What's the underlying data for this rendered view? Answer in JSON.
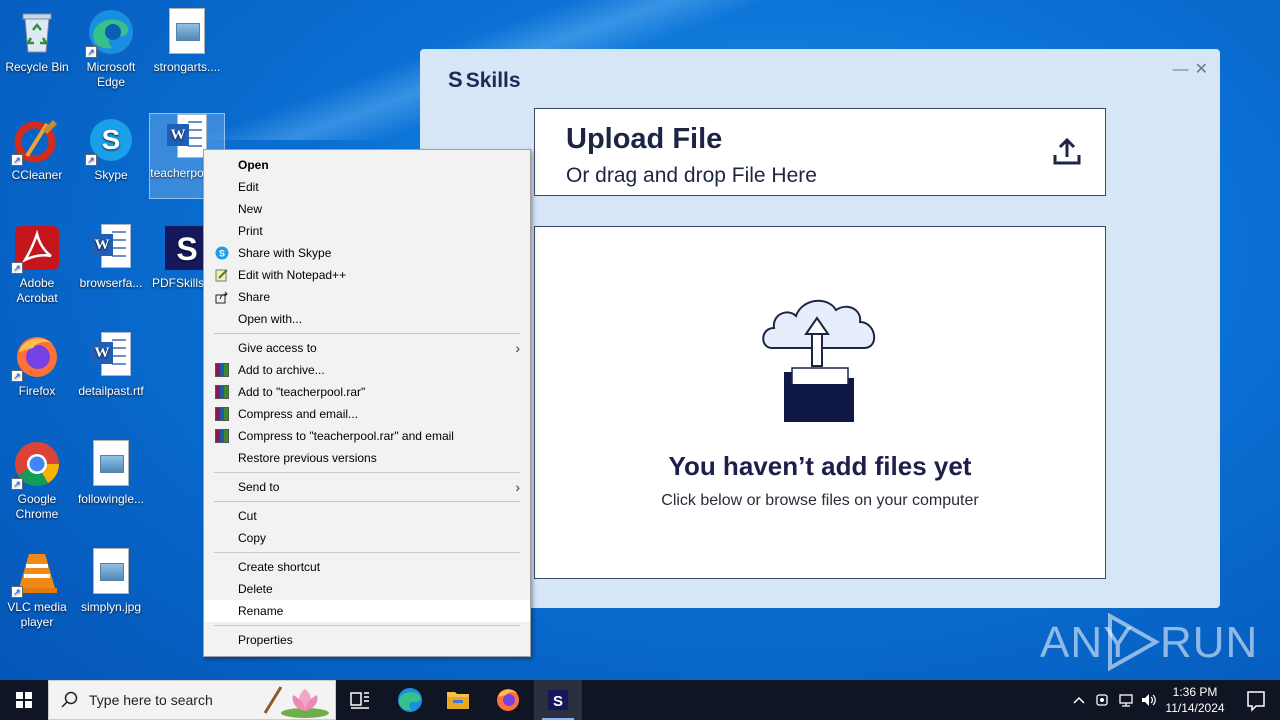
{
  "desktop": {
    "icons": [
      {
        "label": "Recycle Bin"
      },
      {
        "label": "Microsoft Edge"
      },
      {
        "label": "strongarts...."
      },
      {
        "label": "CCleaner"
      },
      {
        "label": "Skype"
      },
      {
        "label": "teacherpo... tf"
      },
      {
        "label": "Adobe Acrobat"
      },
      {
        "label": "browserfa..."
      },
      {
        "label": "PDFSkillsA..."
      },
      {
        "label": "Firefox"
      },
      {
        "label": "detailpast.rtf"
      },
      {
        "label": "Google Chrome"
      },
      {
        "label": "followingle..."
      },
      {
        "label": "VLC media player"
      },
      {
        "label": "simplyn.jpg"
      }
    ]
  },
  "app": {
    "logo": "Skills",
    "logo_mark": "S",
    "upload_title": "Upload File",
    "upload_subtitle": "Or drag and drop File Here",
    "empty_title": "You haven’t add files yet",
    "empty_subtitle": "Click below or browse files on your computer",
    "minimize": "—",
    "close": "✕"
  },
  "context_menu": {
    "items": [
      {
        "label": "Open"
      },
      {
        "label": "Edit"
      },
      {
        "label": "New"
      },
      {
        "label": "Print"
      },
      {
        "label": "Share with Skype"
      },
      {
        "label": "Edit with Notepad++"
      },
      {
        "label": "Share"
      },
      {
        "label": "Open with..."
      },
      {
        "label": "Give access to"
      },
      {
        "label": "Add to archive..."
      },
      {
        "label": "Add to \"teacherpool.rar\""
      },
      {
        "label": "Compress and email..."
      },
      {
        "label": "Compress to \"teacherpool.rar\" and email"
      },
      {
        "label": "Restore previous versions"
      },
      {
        "label": "Send to"
      },
      {
        "label": "Cut"
      },
      {
        "label": "Copy"
      },
      {
        "label": "Create shortcut"
      },
      {
        "label": "Delete"
      },
      {
        "label": "Rename"
      },
      {
        "label": "Properties"
      }
    ]
  },
  "taskbar": {
    "search_placeholder": "Type here to search",
    "time": "1:36 PM",
    "date": "11/14/2024"
  },
  "watermark": {
    "left": "ANY",
    "right": "RUN"
  }
}
